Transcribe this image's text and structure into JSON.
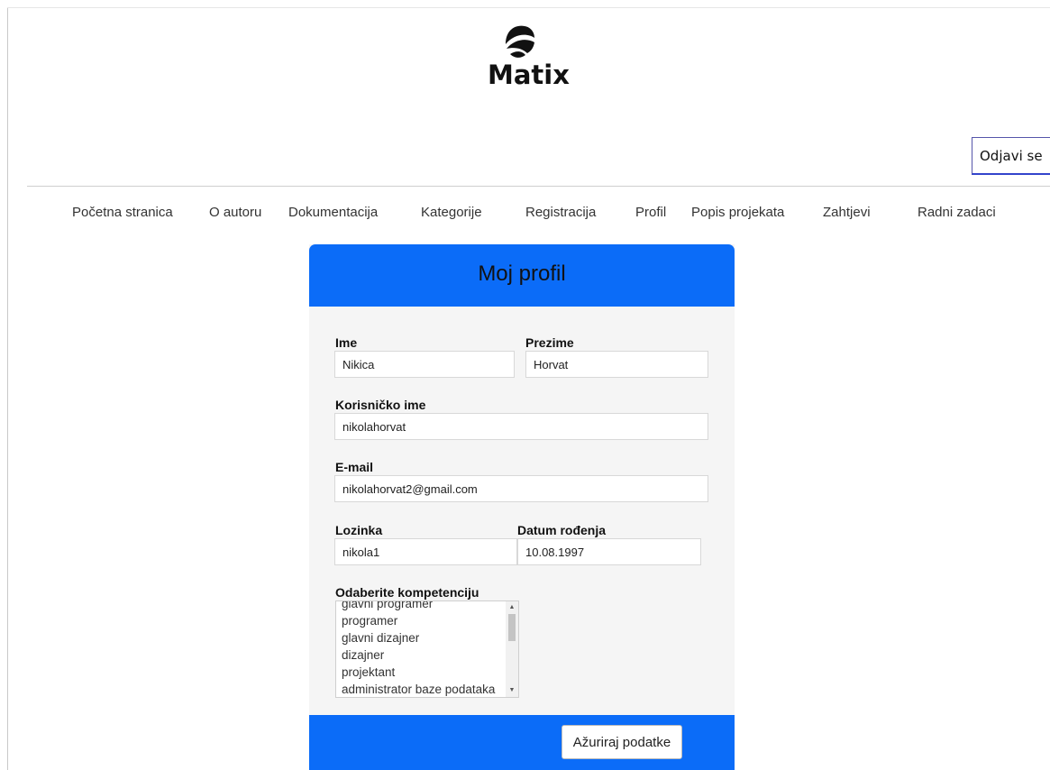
{
  "brand": {
    "name": "Matix"
  },
  "header": {
    "logout_label": "Odjavi se"
  },
  "nav": {
    "items": [
      "Početna stranica",
      "O autoru",
      "Dokumentacija",
      "Kategorije",
      "Registracija",
      "Profil",
      "Popis projekata",
      "Zahtjevi",
      "Radni zadaci"
    ]
  },
  "profile": {
    "title": "Moj profil",
    "first_name": {
      "label": "Ime",
      "value": "Nikica"
    },
    "last_name": {
      "label": "Prezime",
      "value": "Horvat"
    },
    "username": {
      "label": "Korisničko ime",
      "value": "nikolahorvat"
    },
    "email": {
      "label": "E-mail",
      "value": "nikolahorvat2@gmail.com"
    },
    "password": {
      "label": "Lozinka",
      "value": "nikola1"
    },
    "birth_date": {
      "label": "Datum rođenja",
      "value": "10.08.1997"
    },
    "competence": {
      "label": "Odaberite kompetenciju",
      "options": [
        "glavni programer",
        "programer",
        "glavni dizajner",
        "dizajner",
        "projektant",
        "administrator baze podataka"
      ]
    },
    "update_label": "Ažuriraj podatke"
  },
  "colors": {
    "primary": "#0b6cf8",
    "card_bg": "#f5f5f5",
    "text": "#333333"
  },
  "icons": {
    "logo": "shell-logo-icon",
    "scroll_up": "arrow-up-icon",
    "scroll_down": "arrow-down-icon"
  }
}
